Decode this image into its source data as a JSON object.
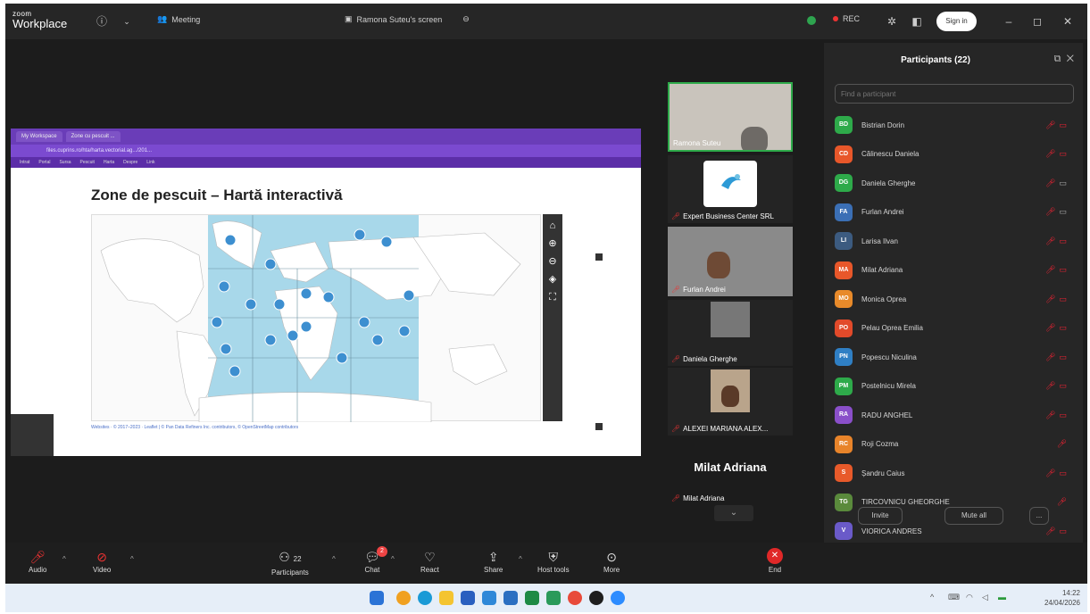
{
  "titlebar": {
    "logo_small": "zoom",
    "logo_big": "Workplace",
    "meeting_label": "Meeting",
    "screen_label": "Ramona Suteu's screen",
    "rec_label": "REC",
    "signin_label": "Sign in"
  },
  "share": {
    "browser_tabs": [
      "My Workspace",
      "Zone cu pescuit ..."
    ],
    "url": "files.cuprins.ro/hta/harta.vectorial.ag.../201...",
    "bookmarks": [
      "Intrat",
      "Portal",
      "Sursa",
      "Pescuit",
      "Harta",
      "Despre",
      "Link"
    ],
    "map_title": "Zone de pescuit – Hartă interactivă",
    "map_footer": "Websites · © 2017–2023 · Leaflet | © Pan Data Refiners Inc. contributors, © OpenStreetMap contributors"
  },
  "tiles": [
    {
      "name": "Ramona Suteu"
    },
    {
      "name": "Expert Business Center SRL"
    },
    {
      "name": "Furlan Andrei"
    },
    {
      "name": "Daniela Gherghe"
    },
    {
      "name": "ALEXEI MARIANA ALEX..."
    },
    {
      "big_name": "Milat Adriana",
      "name": "Milat Adriana"
    }
  ],
  "panel": {
    "title": "Participants (22)",
    "search_placeholder": "Find a participant",
    "participants": [
      {
        "initials": "BD",
        "name": "Bistrian Dorin",
        "color": "#2eaa4a"
      },
      {
        "initials": "CD",
        "name": "Călinescu Daniela",
        "color": "#e8572a"
      },
      {
        "initials": "DG",
        "name": "Daniela Gherghe",
        "color": "#2eaa4a"
      },
      {
        "initials": "FA",
        "name": "Furlan Andrei",
        "color": "#3b6fb5"
      },
      {
        "initials": "LI",
        "name": "Larisa Ilvan",
        "color": "#3c5b80"
      },
      {
        "initials": "MA",
        "name": "Milat Adriana",
        "color": "#e8572a"
      },
      {
        "initials": "MO",
        "name": "Monica Oprea",
        "color": "#e88a2a"
      },
      {
        "initials": "PO",
        "name": "Pelau Oprea Emilia",
        "color": "#e24a2a"
      },
      {
        "initials": "PN",
        "name": "Popescu Niculina",
        "color": "#2f7fc4"
      },
      {
        "initials": "PM",
        "name": "Postelnicu Mirela",
        "color": "#2eaa4a"
      },
      {
        "initials": "RA",
        "name": "RADU ANGHEL",
        "color": "#8a4fc9"
      },
      {
        "initials": "RC",
        "name": "Roji Cozma",
        "color": "#e8842a"
      },
      {
        "initials": "S",
        "name": "Șandru Caius",
        "color": "#e85a2a"
      },
      {
        "initials": "TG",
        "name": "TIRCOVNICU GHEORGHE",
        "color": "#5a8a3c"
      },
      {
        "initials": "V",
        "name": "VIORICA ANDRES",
        "color": "#6a5ac9"
      }
    ],
    "invite_label": "Invite",
    "mute_all_label": "Mute all",
    "more_label": "..."
  },
  "toolbar": {
    "audio": "Audio",
    "video": "Video",
    "participants": "Participants",
    "participants_count": "22",
    "chat": "Chat",
    "chat_badge": "2",
    "react": "React",
    "share": "Share",
    "host_tools": "Host tools",
    "more": "More",
    "end": "End"
  },
  "taskbar": {
    "time": "14:22",
    "date": "24/04/2026"
  },
  "colors": {
    "accent": "#2eaa4a",
    "danger": "#e02828",
    "ocean": "#a8d8ea",
    "share_tab": "#6a3db8"
  }
}
